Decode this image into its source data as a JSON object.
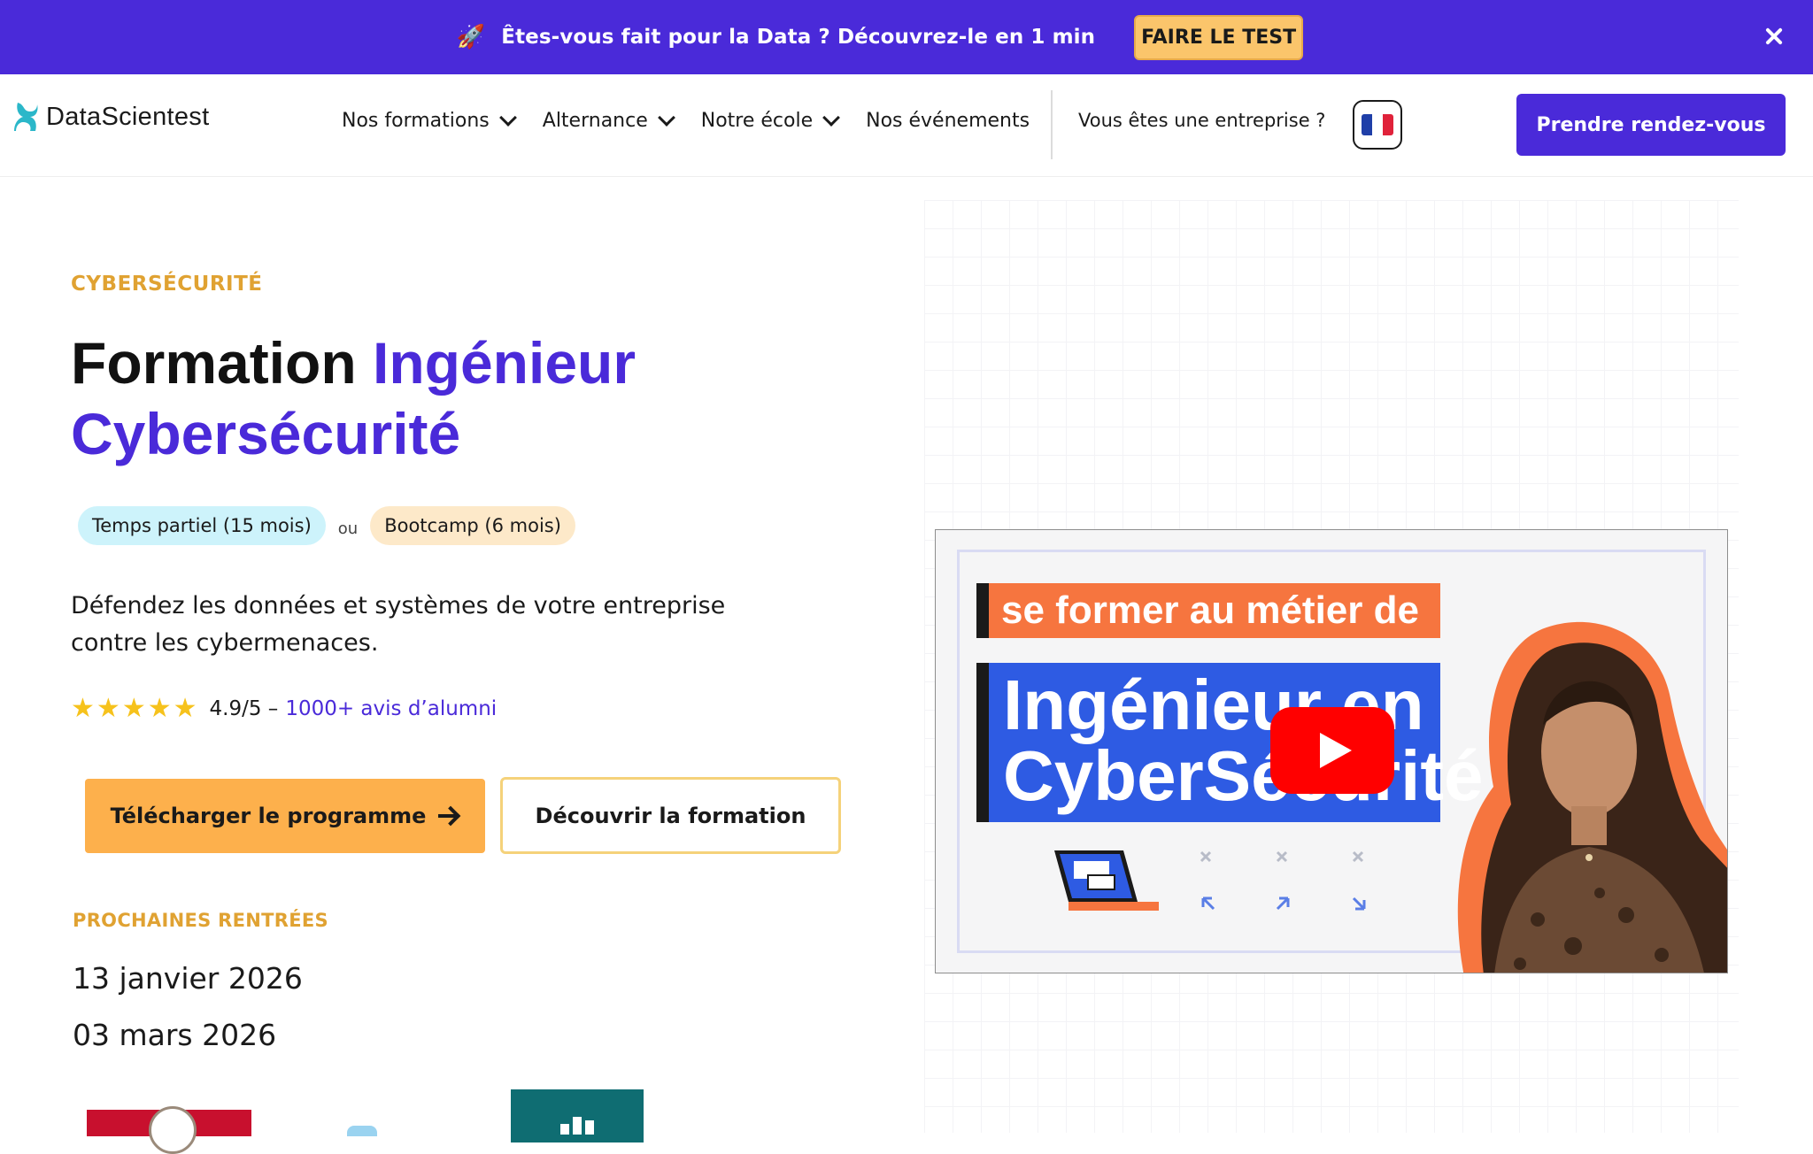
{
  "banner": {
    "icon": "rocket-icon",
    "text": "Êtes-vous fait pour la Data ? Découvrez-le en 1 min",
    "cta": "FAIRE LE TEST"
  },
  "header": {
    "logo_text": "DataScientest",
    "nav": [
      {
        "label": "Nos formations",
        "has_dropdown": true
      },
      {
        "label": "Alternance",
        "has_dropdown": true
      },
      {
        "label": "Notre école",
        "has_dropdown": true
      },
      {
        "label": "Nos événements",
        "has_dropdown": false
      }
    ],
    "enterprise_link": "Vous êtes une entreprise ?",
    "language_flag": "french-flag-icon",
    "cta": "Prendre rendez-vous"
  },
  "hero": {
    "eyebrow": "CYBERSÉCURITÉ",
    "title_plain": "Formation ",
    "title_accent_1": "Ingénieur",
    "title_accent_2": "Cybersécurité",
    "pills": {
      "part_time": "Temps partiel (15 mois)",
      "separator": "ou",
      "bootcamp": "Bootcamp (6 mois)"
    },
    "description": "Défendez les données et systèmes de votre  entreprise contre les cybermenaces.",
    "rating": {
      "stars": 5,
      "score": "4.9/5 –",
      "reviews_link": "1000+ avis d’alumni"
    },
    "primary_cta": "Télécharger le programme",
    "secondary_cta": "Découvrir la formation",
    "next_intakes_title": "PROCHAINES RENTRÉES",
    "next_intakes": [
      "13 janvier 2026",
      "03 mars 2026"
    ]
  },
  "video": {
    "line1": "se former au métier de",
    "line2a": "Ingénieur en",
    "line2b": "CyberSécurité"
  },
  "colors": {
    "brand_purple": "#4a2ad9",
    "accent_orange": "#fdb04c",
    "eyebrow_gold": "#e0a232"
  }
}
